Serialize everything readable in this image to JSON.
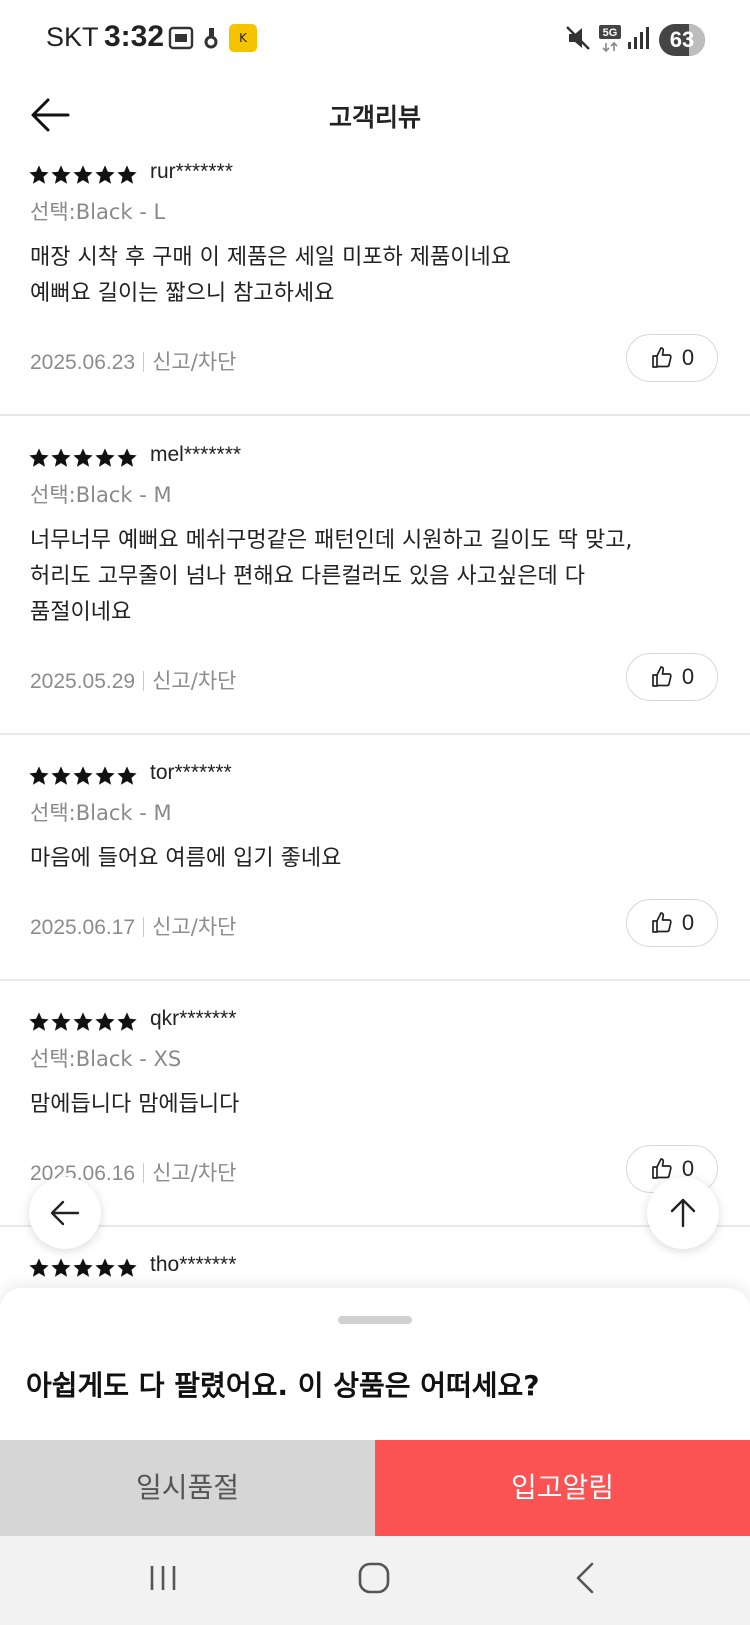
{
  "status_bar": {
    "carrier": "SKT",
    "time": "3:32",
    "battery": "63",
    "network": "5G"
  },
  "header": {
    "title": "고객리뷰",
    "back_icon": "arrow-left-icon"
  },
  "reviews": [
    {
      "rating": 5,
      "user": "rur*******",
      "option": "선택:Black - L",
      "text": "매장 시착 후 구매  이 제품은 세일 미포하 제품이네요\n예뻐요  길이는 짧으니 참고하세요",
      "date": "2025.06.23",
      "report": "신고/차단",
      "likes": "0"
    },
    {
      "rating": 5,
      "user": "mel*******",
      "option": "선택:Black - M",
      "text": "너무너무 예뻐요 메쉬구멍같은 패턴인데 시원하고 길이도 딱 맞고,\n허리도 고무줄이 넘나 편해요 다른컬러도 있음 사고싶은데 다\n품절이네요",
      "date": "2025.05.29",
      "report": "신고/차단",
      "likes": "0"
    },
    {
      "rating": 5,
      "user": "tor*******",
      "option": "선택:Black - M",
      "text": "마음에 들어요 여름에 입기 좋네요",
      "date": "2025.06.17",
      "report": "신고/차단",
      "likes": "0"
    },
    {
      "rating": 5,
      "user": "qkr*******",
      "option": "선택:Black - XS",
      "text": "맘에듭니다 맘에듭니다",
      "date": "2025.06.16",
      "report": "신고/차단",
      "likes": "0"
    },
    {
      "rating": 5,
      "user": "tho*******"
    }
  ],
  "floating": {
    "back_icon": "arrow-left-icon",
    "top_icon": "arrow-up-icon"
  },
  "sheet": {
    "title": "아쉽게도 다 팔렸어요. 이 상품은 어떠세요?"
  },
  "actions": {
    "soldout_label": "일시품절",
    "notify_label": "입고알림"
  },
  "colors": {
    "accent": "#fb5253",
    "soldout_bg": "#d6d6d6",
    "star": "#111111"
  }
}
